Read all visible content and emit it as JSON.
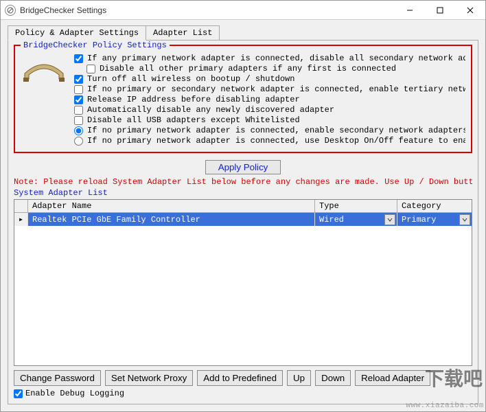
{
  "window": {
    "title": "BridgeChecker Settings"
  },
  "tabs": [
    {
      "label": "Policy & Adapter Settings",
      "active": true
    },
    {
      "label": "Adapter List",
      "active": false
    }
  ],
  "group": {
    "legend": "BridgeChecker Policy Settings"
  },
  "policies": {
    "p1": {
      "label": "If any primary network adapter is connected, disable all secondary network adapters",
      "checked": true
    },
    "p1a": {
      "label": "Disable all other primary adapters if any first is connected",
      "checked": false
    },
    "p2": {
      "label": "Turn off all wireless on bootup / shutdown",
      "checked": true
    },
    "p3": {
      "label": "If no primary or secondary network adapter is connected, enable tertiary network adapters",
      "checked": false
    },
    "p4": {
      "label": "Release IP address before disabling adapter",
      "checked": true
    },
    "p5": {
      "label": "Automatically disable any newly discovered adapter",
      "checked": false
    },
    "p6": {
      "label": "Disable all USB adapters except Whitelisted",
      "checked": false
    },
    "r1": {
      "label": "If no primary network adapter is connected, enable secondary network adapters",
      "selected": true
    },
    "r2": {
      "label": "If no primary network adapter is connected, use Desktop On/Off feature to enable secondary n",
      "selected": false
    }
  },
  "apply": {
    "label": "Apply Policy"
  },
  "note": "Note: Please reload System Adapter List below before any changes are made. Use Up / Down buttons to",
  "adapter_label": "System Adapter List",
  "grid": {
    "headers": {
      "name": "Adapter Name",
      "type": "Type",
      "category": "Category"
    },
    "rows": [
      {
        "name": "Realtek PCIe GbE Family Controller",
        "type": "Wired",
        "category": "Primary",
        "selected": true
      }
    ]
  },
  "buttons": {
    "change_pw": "Change Password",
    "set_proxy": "Set Network Proxy",
    "add_predef": "Add to Predefined",
    "up": "Up",
    "down": "Down",
    "reload": "Reload Adapter"
  },
  "debug": {
    "label": "Enable Debug Logging",
    "checked": true
  },
  "watermark": {
    "big": "下载吧",
    "url": "www.xiazaiba.com"
  }
}
